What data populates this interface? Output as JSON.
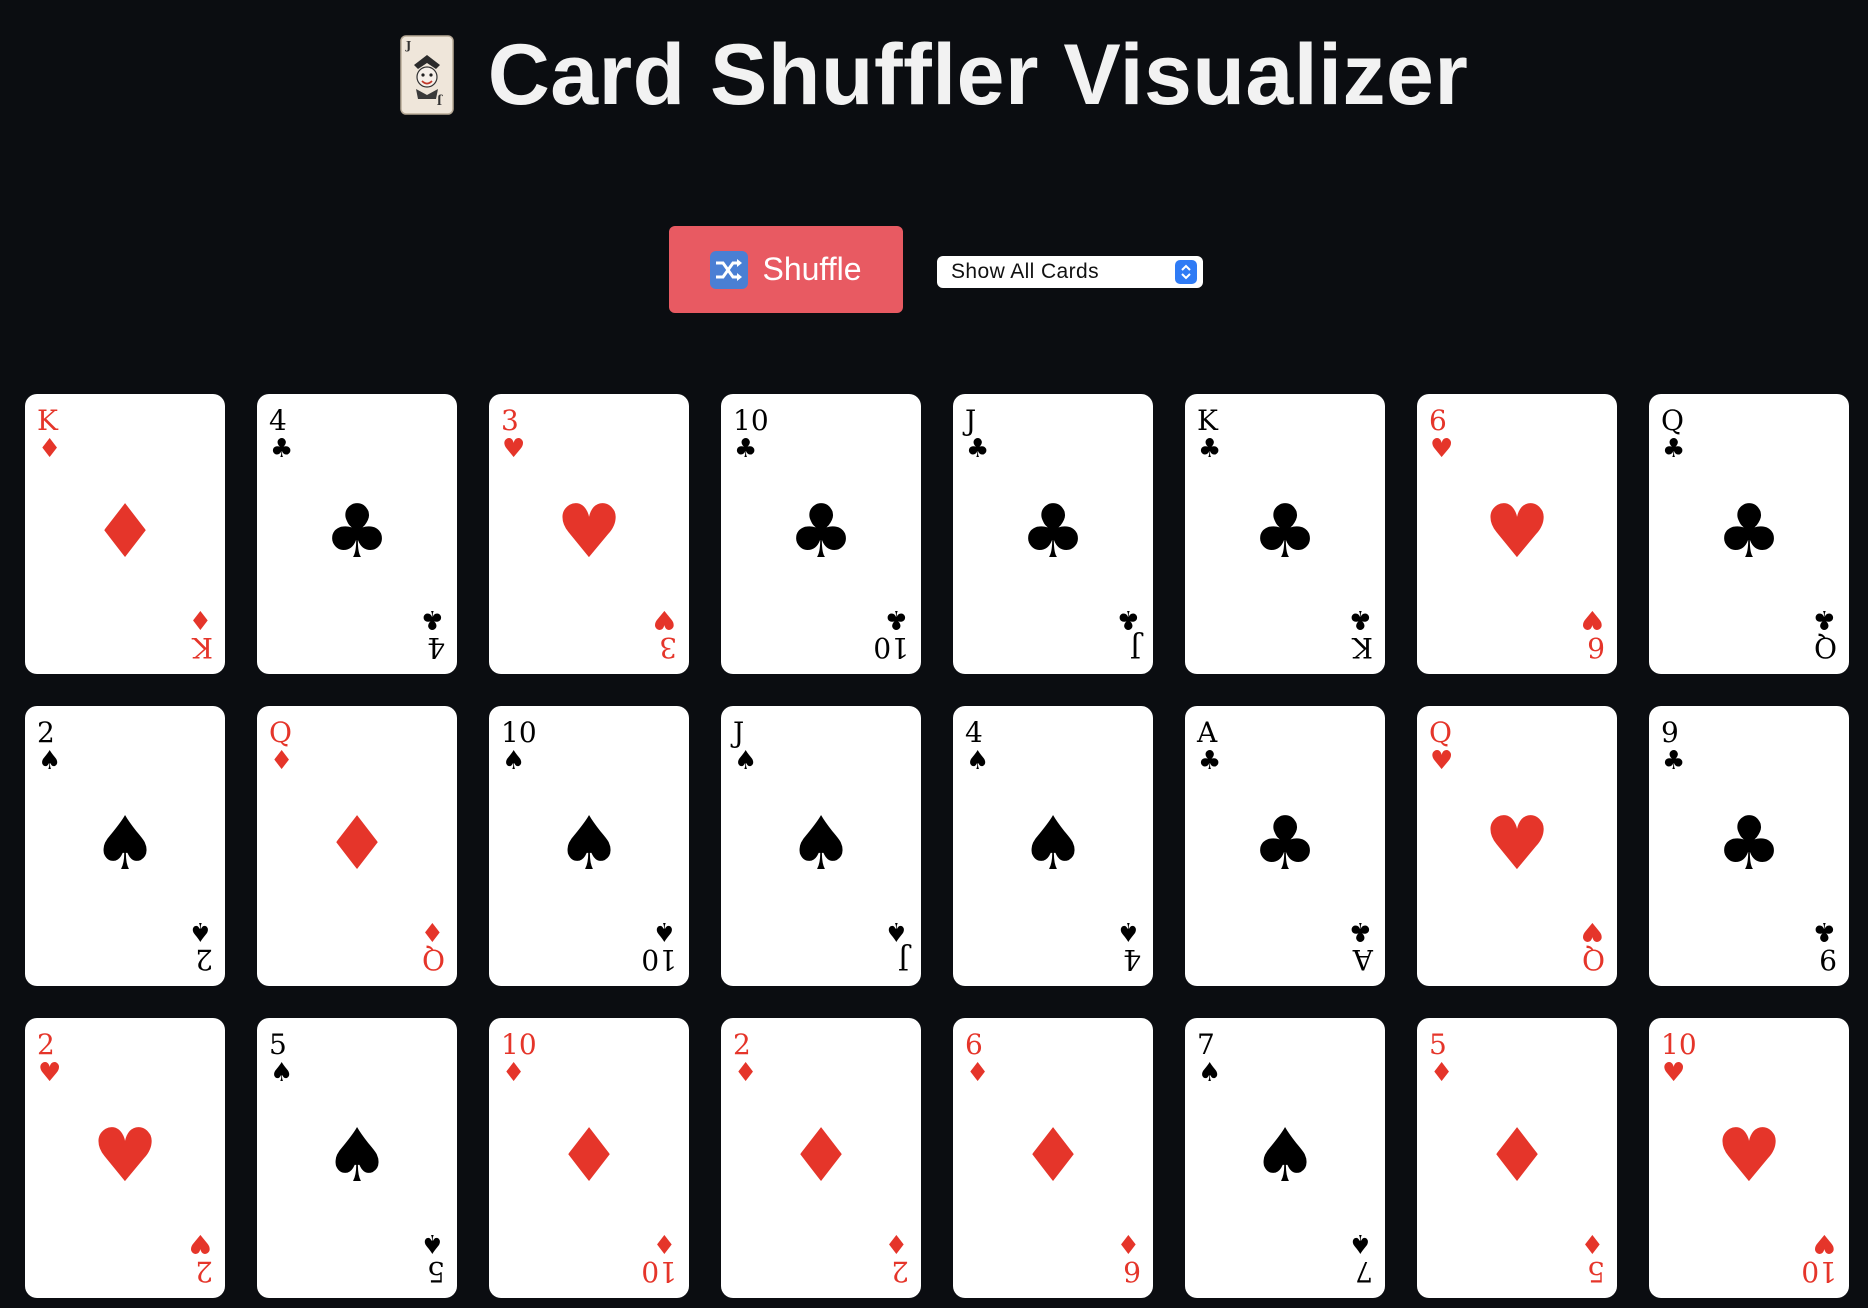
{
  "header": {
    "title": "Card Shuffler Visualizer",
    "icon": "joker-card-icon"
  },
  "controls": {
    "shuffle_label": "Shuffle",
    "shuffle_icon": "shuffle-icon",
    "view_select_value": "Show All Cards"
  },
  "colors": {
    "background": "#0b0d11",
    "accent_button": "#e85a62",
    "red_suit": "#e5352a",
    "black_suit": "#000000"
  },
  "cards": [
    {
      "rank": "K",
      "suit": "♦",
      "color": "red"
    },
    {
      "rank": "4",
      "suit": "♣",
      "color": "black"
    },
    {
      "rank": "3",
      "suit": "♥",
      "color": "red"
    },
    {
      "rank": "10",
      "suit": "♣",
      "color": "black"
    },
    {
      "rank": "J",
      "suit": "♣",
      "color": "black"
    },
    {
      "rank": "K",
      "suit": "♣",
      "color": "black"
    },
    {
      "rank": "6",
      "suit": "♥",
      "color": "red"
    },
    {
      "rank": "Q",
      "suit": "♣",
      "color": "black"
    },
    {
      "rank": "2",
      "suit": "♠",
      "color": "black"
    },
    {
      "rank": "Q",
      "suit": "♦",
      "color": "red"
    },
    {
      "rank": "10",
      "suit": "♠",
      "color": "black"
    },
    {
      "rank": "J",
      "suit": "♠",
      "color": "black"
    },
    {
      "rank": "4",
      "suit": "♠",
      "color": "black"
    },
    {
      "rank": "A",
      "suit": "♣",
      "color": "black"
    },
    {
      "rank": "Q",
      "suit": "♥",
      "color": "red"
    },
    {
      "rank": "9",
      "suit": "♣",
      "color": "black"
    },
    {
      "rank": "2",
      "suit": "♥",
      "color": "red"
    },
    {
      "rank": "5",
      "suit": "♠",
      "color": "black"
    },
    {
      "rank": "10",
      "suit": "♦",
      "color": "red"
    },
    {
      "rank": "2",
      "suit": "♦",
      "color": "red"
    },
    {
      "rank": "6",
      "suit": "♦",
      "color": "red"
    },
    {
      "rank": "7",
      "suit": "♠",
      "color": "black"
    },
    {
      "rank": "5",
      "suit": "♦",
      "color": "red"
    },
    {
      "rank": "10",
      "suit": "♥",
      "color": "red"
    }
  ]
}
